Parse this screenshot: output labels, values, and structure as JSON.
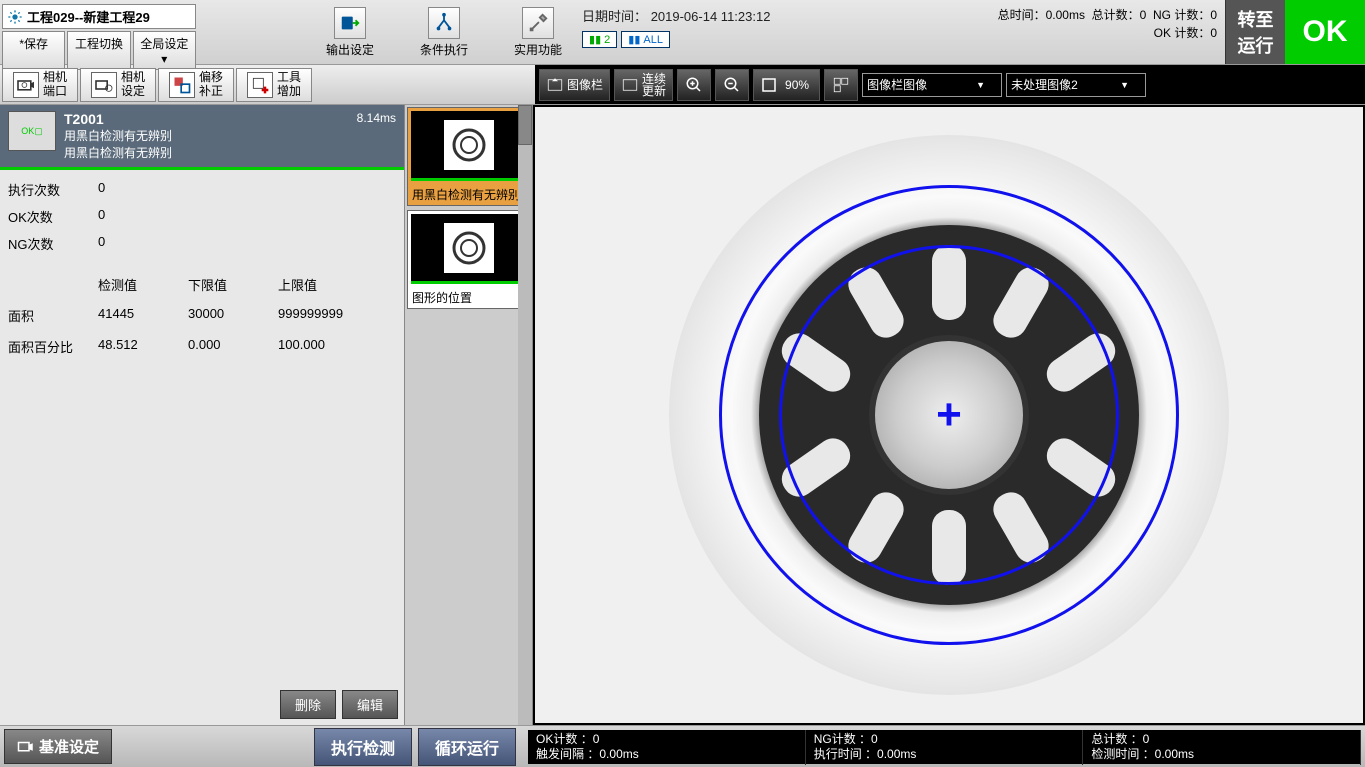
{
  "topbar": {
    "project_title": "工程029--新建工程29",
    "save_btn": "*保存",
    "switch_btn": "工程切换",
    "global_btn": "全局设定 ▾",
    "output_set": "输出设定",
    "cond_exec": "条件执行",
    "utility": "实用功能",
    "datetime_label": "日期时间：",
    "datetime_value": "2019-06-14 11:23:12",
    "ind_2": "2",
    "ind_all": "ALL",
    "total_time": "总时间：0.00ms",
    "total_count": "总计数：0",
    "ng_count": "NG 计数：0",
    "ok_count": "OK 计数：0",
    "run_label": "转至\n运行",
    "ok_big": "OK"
  },
  "toolbar2": {
    "cam_port": "相机\n端口",
    "cam_set": "相机\n设定",
    "offset": "偏移\n补正",
    "tool_add": "工具\n增加",
    "img_bar": "图像栏",
    "cont_update": "连续\n更新",
    "zoom_pct": "90%",
    "dd1": "图像栏图像",
    "dd2": "未处理图像2"
  },
  "tool": {
    "name": "T2001",
    "sub1": "用黑白检测有无辨别",
    "sub2": "用黑白检测有无辨别",
    "ms": "8.14ms"
  },
  "stats": {
    "exec_label": "执行次数",
    "exec_val": "0",
    "ok_label": "OK次数",
    "ok_val": "0",
    "ng_label": "NG次数",
    "ng_val": "0"
  },
  "grid": {
    "h_detect": "检测值",
    "h_lower": "下限值",
    "h_upper": "上限值",
    "r1_label": "面积",
    "r1_det": "41445",
    "r1_low": "30000",
    "r1_up": "999999999",
    "r2_label": "面积百分比",
    "r2_det": "48.512",
    "r2_low": "0.000",
    "r2_up": "100.000"
  },
  "left_btn": {
    "delete": "删除",
    "edit": "编辑"
  },
  "thumbs": {
    "t1_label": "用黑白检测有无辨别",
    "t2_label": "图形的位置"
  },
  "action": {
    "base_set": "基准设定",
    "exec": "执行检测",
    "loop": "循环运行"
  },
  "status": {
    "ok_cnt": "OK计数 ：0",
    "trig": "触发间隔 ：0.00ms",
    "ng_cnt": "NG计数 ：0",
    "exec_t": "执行时间 ：0.00ms",
    "tot_cnt": "总计数 ：0",
    "det_t": "检测时间 ：0.00ms"
  }
}
